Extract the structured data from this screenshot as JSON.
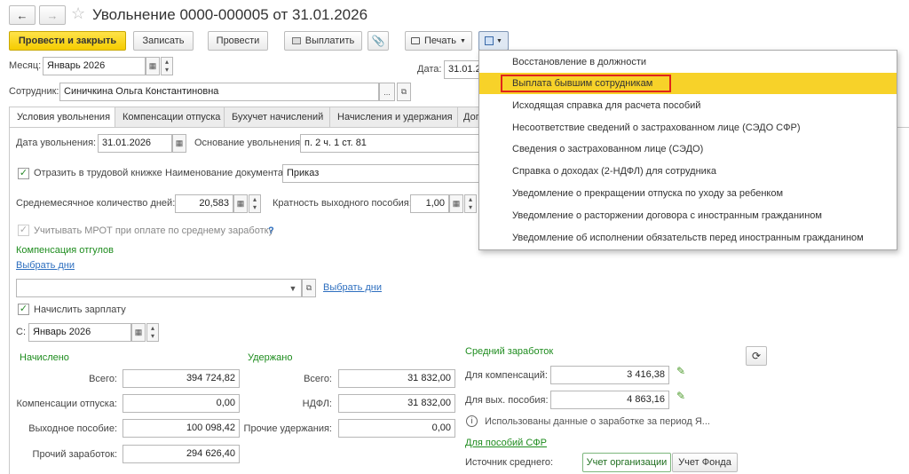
{
  "title": "Увольнение 0000-000005 от 31.01.2026",
  "toolbar": {
    "post_close": "Провести и закрыть",
    "save": "Записать",
    "post": "Провести",
    "pay": "Выплатить",
    "print": "Печать"
  },
  "header": {
    "month_label": "Месяц:",
    "month_value": "Январь 2026",
    "date_label": "Дата:",
    "date_value": "31.01.2",
    "employee_label": "Сотрудник:",
    "employee_value": "Синичкина Ольга Константиновна"
  },
  "tabs": [
    "Условия увольнения",
    "Компенсации отпуска",
    "Бухучет начислений",
    "Начисления и удержания",
    "Доп"
  ],
  "form": {
    "dismissal_date_label": "Дата увольнения:",
    "dismissal_date_value": "31.01.2026",
    "basis_label": "Основание увольнения:",
    "basis_value": "п. 2 ч. 1 ст. 81",
    "reflect_label": "Отразить в трудовой книжке",
    "doc_name_label": "Наименование документа:",
    "doc_name_value": "Приказ",
    "avg_days_label": "Среднемесячное количество дней:",
    "avg_days_value": "20,583",
    "severance_mult_label": "Кратность выходного пособия:",
    "severance_mult_value": "1,00",
    "mrot_label": "Учитывать МРОТ при оплате по среднему заработку",
    "mrot_help": "?",
    "leave_comp_heading": "Компенсация отгулов",
    "select_days_1": "Выбрать дни",
    "select_days_2": "Выбрать дни",
    "accrue_label": "Начислить зарплату",
    "from_label": "С:",
    "from_value": "Январь 2026"
  },
  "accrued": {
    "heading": "Начислено",
    "total_label": "Всего:",
    "total_value": "394 724,82",
    "vacation_comp_label": "Компенсации отпуска:",
    "vacation_comp_value": "0,00",
    "severance_label": "Выходное пособие:",
    "severance_value": "100 098,42",
    "other_label": "Прочий заработок:",
    "other_value": "294 626,40"
  },
  "withheld": {
    "heading": "Удержано",
    "total_label": "Всего:",
    "total_value": "31 832,00",
    "ndfl_label": "НДФЛ:",
    "ndfl_value": "31 832,00",
    "other_label": "Прочие удержания:",
    "other_value": "0,00"
  },
  "avg_earnings": {
    "heading": "Средний заработок",
    "for_comp_label": "Для компенсаций:",
    "for_comp_value": "3 416,38",
    "for_severance_label": "Для вых. пособия:",
    "for_severance_value": "4 863,16",
    "info_text": "Использованы данные о заработке за период Я...",
    "sfr_link": "Для пособий СФР",
    "source_label": "Источник среднего:",
    "source_org": "Учет организации",
    "source_fund": "Учет Фонда"
  },
  "menu_items": [
    "Восстановление в должности",
    "Выплата бывшим сотрудникам",
    "Исходящая справка для расчета пособий",
    "Несоответствие сведений о застрахованном лице (СЭДО СФР)",
    "Сведения о застрахованном лице (СЭДО)",
    "Справка о доходах (2-НДФЛ) для сотрудника",
    "Уведомление о прекращении отпуска по уходу за ребенком",
    "Уведомление о расторжении договора с иностранным гражданином",
    "Уведомление об исполнении обязательств перед иностранным гражданином"
  ],
  "colors": {
    "accent_yellow": "#f5cc00",
    "highlight_border": "#e0251b",
    "green_text": "#1e8c1e",
    "link_blue": "#2e6fbf"
  }
}
